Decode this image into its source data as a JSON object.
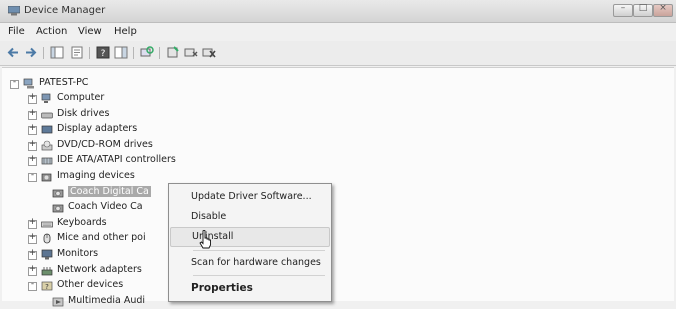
{
  "window": {
    "title": "Device Manager"
  },
  "menu": [
    "File",
    "Action",
    "View",
    "Help"
  ],
  "tree": {
    "root": "PATEST-PC",
    "items": [
      {
        "label": "Computer",
        "icon": "computer-icon",
        "expander": "+"
      },
      {
        "label": "Disk drives",
        "icon": "disk-drive-icon",
        "expander": "+"
      },
      {
        "label": "Display adapters",
        "icon": "display-adapter-icon",
        "expander": "+"
      },
      {
        "label": "DVD/CD-ROM drives",
        "icon": "dvd-drive-icon",
        "expander": "+"
      },
      {
        "label": "IDE ATA/ATAPI controllers",
        "icon": "ide-controller-icon",
        "expander": "+"
      },
      {
        "label": "Imaging devices",
        "icon": "imaging-device-icon",
        "expander": "-"
      },
      {
        "label": "Coach Digital Ca",
        "icon": "camera-icon",
        "expander": ""
      },
      {
        "label": "Coach Video Ca",
        "icon": "camera-icon",
        "expander": ""
      },
      {
        "label": "Keyboards",
        "icon": "keyboard-icon",
        "expander": "+"
      },
      {
        "label": "Mice and other poi",
        "icon": "mouse-icon",
        "expander": "+"
      },
      {
        "label": "Monitors",
        "icon": "monitor-icon",
        "expander": "+"
      },
      {
        "label": "Network adapters",
        "icon": "network-adapter-icon",
        "expander": "+"
      },
      {
        "label": "Other devices",
        "icon": "other-devices-icon",
        "expander": "-"
      },
      {
        "label": "Multimedia Audi",
        "icon": "multimedia-icon",
        "expander": ""
      }
    ]
  },
  "context_menu": {
    "items": [
      "Update Driver Software...",
      "Disable",
      "Uninstall",
      "Scan for hardware changes",
      "Properties"
    ]
  },
  "colors": {
    "selection": "#a9a9a9",
    "menu_hover": "#e8e8e8"
  }
}
